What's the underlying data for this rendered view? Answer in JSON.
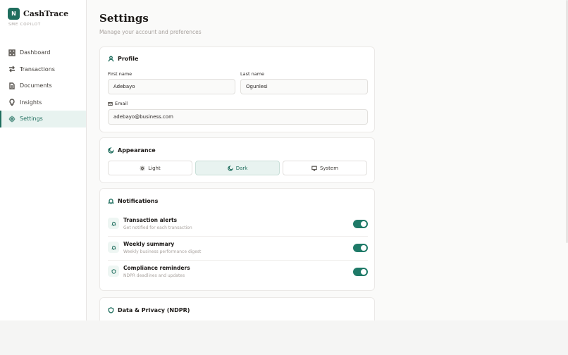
{
  "brand": {
    "logo_letter": "N",
    "name": "CashTrace",
    "subtitle": "SME COPILOT"
  },
  "sidebar": {
    "items": [
      {
        "label": "Dashboard",
        "icon": "grid-icon"
      },
      {
        "label": "Transactions",
        "icon": "arrows-icon"
      },
      {
        "label": "Documents",
        "icon": "document-icon"
      },
      {
        "label": "Insights",
        "icon": "lightbulb-icon"
      },
      {
        "label": "Settings",
        "icon": "gear-icon",
        "active": true
      }
    ]
  },
  "page": {
    "title": "Settings",
    "subtitle": "Manage your account and preferences"
  },
  "profile": {
    "heading": "Profile",
    "first_name_label": "First name",
    "first_name_value": "Adebayo",
    "last_name_label": "Last name",
    "last_name_value": "Ogunlesi",
    "email_label": "Email",
    "email_value": "adebayo@business.com"
  },
  "appearance": {
    "heading": "Appearance",
    "options": [
      {
        "label": "Light",
        "icon": "sun-icon"
      },
      {
        "label": "Dark",
        "icon": "moon-icon",
        "selected": true
      },
      {
        "label": "System",
        "icon": "monitor-icon"
      }
    ]
  },
  "notifications": {
    "heading": "Notifications",
    "items": [
      {
        "title": "Transaction alerts",
        "description": "Get notified for each transaction",
        "enabled": true,
        "icon": "bell-icon"
      },
      {
        "title": "Weekly summary",
        "description": "Weekly business performance digest",
        "enabled": true,
        "icon": "bell-icon"
      },
      {
        "title": "Compliance reminders",
        "description": "NDPR deadlines and updates",
        "enabled": true,
        "icon": "shield-icon"
      }
    ]
  },
  "privacy": {
    "heading": "Data & Privacy (NDPR)"
  },
  "colors": {
    "accent": "#1f6e5e",
    "toggle_on": "#1f7a68",
    "active_bg": "#e8f3f0"
  }
}
